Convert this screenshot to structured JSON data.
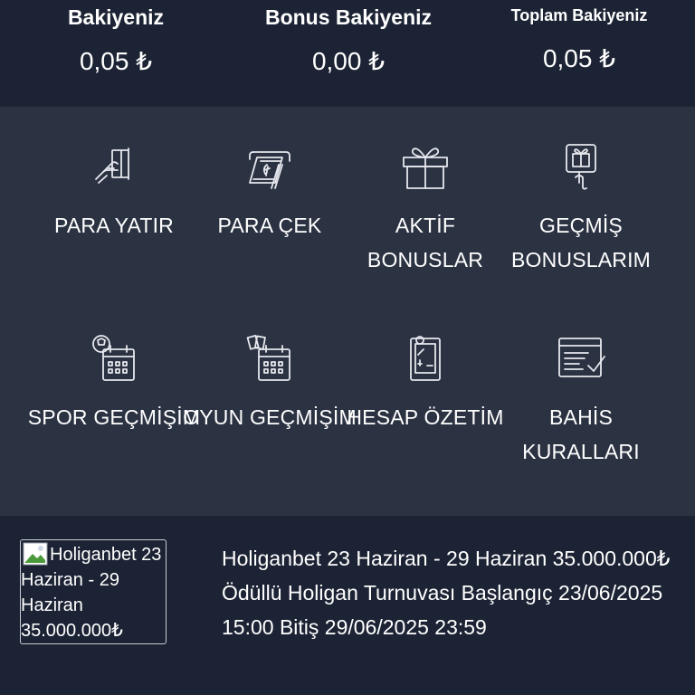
{
  "balances": {
    "main": {
      "title": "Bakiyeniz",
      "value": "0,05 ₺"
    },
    "bonus": {
      "title": "Bonus Bakiyeniz",
      "value": "0,00 ₺"
    },
    "total": {
      "title": "Toplam Bakiyeniz",
      "value": "0,05 ₺"
    }
  },
  "menu": {
    "items": [
      {
        "label": "PARA YATIR",
        "icon": "deposit-card-icon"
      },
      {
        "label": "PARA ÇEK",
        "icon": "withdraw-cash-icon"
      },
      {
        "label": "AKTİF BONUSLAR",
        "icon": "gift-box-icon"
      },
      {
        "label": "GEÇMİŞ BONUSLARIM",
        "icon": "gift-history-icon"
      },
      {
        "label": "SPOR GEÇMİŞİM",
        "icon": "sport-calendar-icon"
      },
      {
        "label": "OYUN GEÇMİŞİM",
        "icon": "game-calendar-icon"
      },
      {
        "label": "HESAP ÖZETİM",
        "icon": "account-summary-icon"
      },
      {
        "label": "BAHİS KURALLARI",
        "icon": "betting-rules-icon"
      }
    ]
  },
  "promo": {
    "image_alt": "Holiganbet 23 Haziran - 29 Haziran 35.000.000₺",
    "text": "Holiganbet 23 Haziran - 29 Haziran 35.000.000₺ Ödüllü Holigan Turnuvası Başlangıç 23/06/2025 15:00 Bitiş 29/06/2025 23:59"
  },
  "colors": {
    "header_bg": "#1c2334",
    "menu_bg": "#2b3242",
    "text": "#ffffff"
  }
}
